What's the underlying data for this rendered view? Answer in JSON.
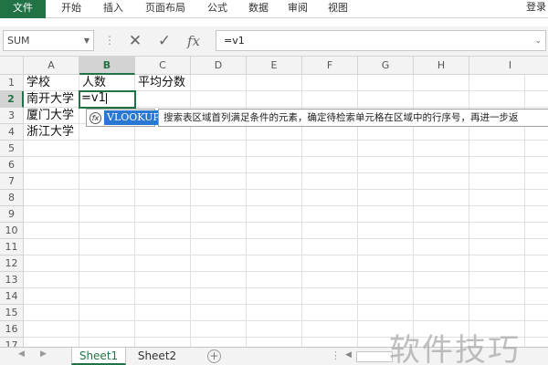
{
  "ribbon": {
    "tabs": [
      {
        "label": "文件",
        "active": true
      },
      {
        "label": "开始",
        "active": false
      },
      {
        "label": "插入",
        "active": false
      },
      {
        "label": "页面布局",
        "active": false
      },
      {
        "label": "公式",
        "active": false
      },
      {
        "label": "数据",
        "active": false
      },
      {
        "label": "审阅",
        "active": false
      },
      {
        "label": "视图",
        "active": false
      }
    ],
    "login_label": "登录",
    "accent_color": "#217346"
  },
  "formula_bar": {
    "name_box": "SUM",
    "cancel_icon": "✕",
    "enter_icon": "✓",
    "function_icon": "fx",
    "formula": "=v1",
    "dots": "⋮"
  },
  "grid": {
    "columns": [
      "A",
      "B",
      "C",
      "D",
      "E",
      "F",
      "G",
      "H",
      "I"
    ],
    "rows": [
      "1",
      "2",
      "3",
      "4",
      "5",
      "6",
      "7",
      "8",
      "9",
      "10",
      "11",
      "12",
      "13",
      "14",
      "15",
      "16",
      "17"
    ],
    "selected_column": "B",
    "selected_row": "2",
    "cells": {
      "A1": "学校",
      "B1": "人数",
      "C1": "平均分数",
      "A2": "南开大学",
      "A3": "厦门大学",
      "A4": "浙江大学",
      "B2": "=v1"
    }
  },
  "autocomplete": {
    "function_name": "VLOOKUP",
    "icon_glyph": "fx",
    "description": "搜索表区域首列满足条件的元素，确定待检索单元格在区域中的行序号，再进一步返"
  },
  "sheets": {
    "tabs": [
      {
        "label": "Sheet1",
        "active": true
      },
      {
        "label": "Sheet2",
        "active": false
      }
    ],
    "add_glyph": "+",
    "ellipsis": "⋮"
  },
  "watermark": "软件技巧"
}
